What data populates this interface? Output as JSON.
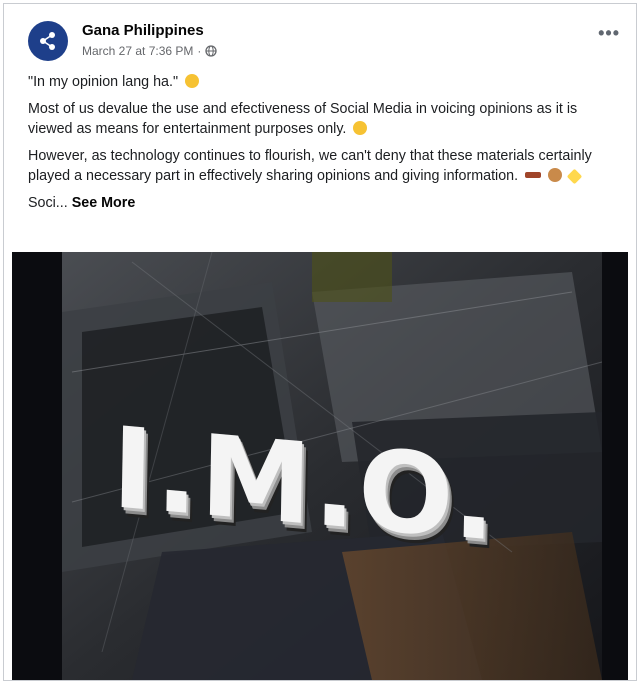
{
  "post": {
    "page_name": "Gana Philippines",
    "date": "March 27 at 7:36 PM",
    "separator": "·",
    "more_label": "•••",
    "paragraphs": [
      "\"In my opinion lang ha.\"",
      "Most of us devalue the use and efectiveness of Social Media in voicing opinions as it is viewed as means for entertainment purposes only.",
      "However, as technology continues to flourish, we can't deny that these materials certainly played a necessary part in effectively sharing opinions and giving information."
    ],
    "truncated_text": "Soci...",
    "see_more": "See More"
  },
  "image": {
    "overlay_text": "I.M.O."
  },
  "icons": [
    "share-icon",
    "globe-icon",
    "more-icon",
    "emoji-icon"
  ],
  "colors": {
    "avatar_bg": "#1e3f8a",
    "meta": "#65676b"
  }
}
